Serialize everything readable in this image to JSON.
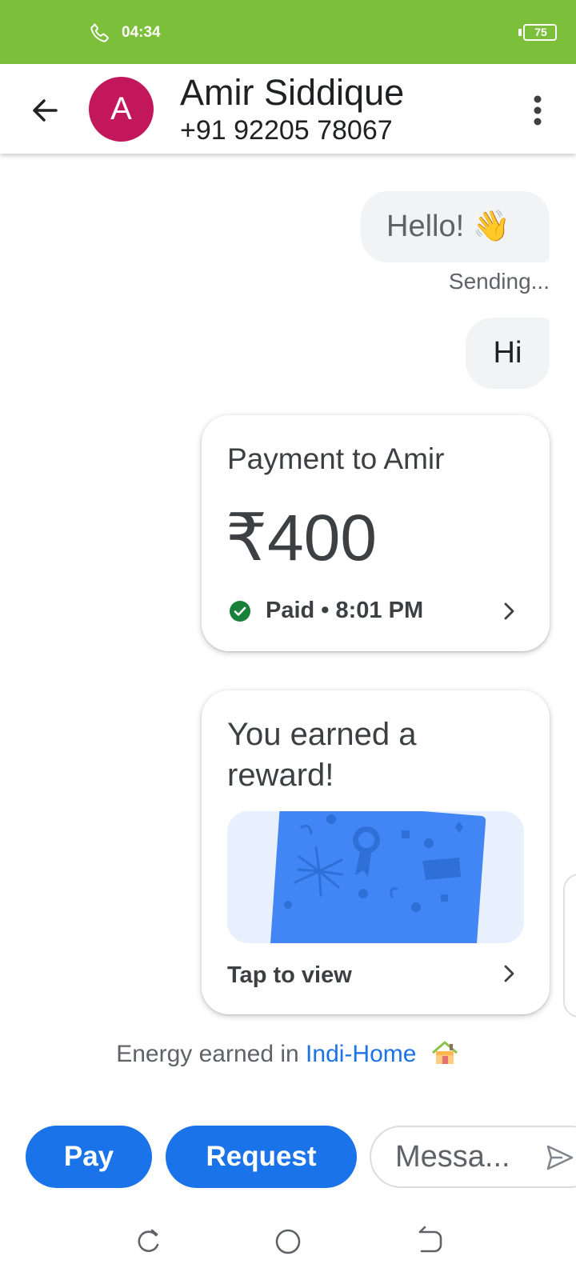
{
  "status_bar": {
    "time": "04:34",
    "battery": "75",
    "call_icon": "phone-icon",
    "background_color": "#7cbf3a"
  },
  "header": {
    "back_icon": "arrow-left-icon",
    "avatar_letter": "A",
    "avatar_color": "#c2185b",
    "contact_name": "Amir Siddique",
    "contact_phone": "+91 92205 78067",
    "menu_icon": "more-vert-icon"
  },
  "messages": [
    {
      "text": "Hello! 👋",
      "status": "Sending..."
    },
    {
      "text": "Hi"
    }
  ],
  "payment_card": {
    "title": "Payment to Amir",
    "amount": "₹400",
    "status": "Paid • 8:01 PM",
    "status_icon": "check-circle-icon",
    "status_color": "#188038"
  },
  "reward_card": {
    "title": "You earned a reward!",
    "action": "Tap to view"
  },
  "energy": {
    "prefix": "Energy earned in",
    "link": "Indi-Home",
    "icon": "house-icon"
  },
  "actions": {
    "pay_label": "Pay",
    "request_label": "Request",
    "message_placeholder": "Messa...",
    "send_icon": "send-icon",
    "accent_color": "#1a73e8"
  },
  "nav": {
    "recent_icon": "recent-apps-icon",
    "home_icon": "home-circle-icon",
    "back_icon": "back-nav-icon"
  }
}
